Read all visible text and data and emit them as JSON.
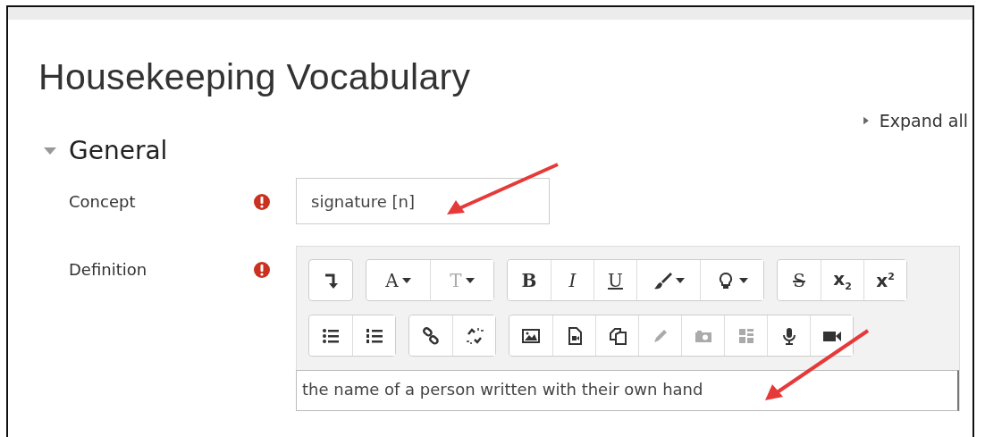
{
  "page": {
    "title": "Housekeeping Vocabulary",
    "expand_all": "Expand all"
  },
  "section": {
    "title": "General",
    "expanded": true
  },
  "fields": [
    {
      "label": "Concept",
      "required": true,
      "kind": "input",
      "value": "signature [n]"
    },
    {
      "label": "Definition",
      "required": true,
      "kind": "editor",
      "value": "the name of a person written with their own hand"
    }
  ],
  "toolbar": [
    [
      [
        {
          "kind": "arrow-down",
          "disabled": false,
          "dropdown": false
        }
      ],
      [
        {
          "kind": "font",
          "label": "A",
          "disabled": false,
          "dropdown": true
        },
        {
          "kind": "font-size",
          "label": "T",
          "disabled": true,
          "dropdown": true
        }
      ],
      [
        {
          "kind": "bold",
          "label": "B",
          "disabled": false,
          "dropdown": false
        },
        {
          "kind": "italic",
          "label": "I",
          "disabled": false,
          "dropdown": false
        },
        {
          "kind": "underline",
          "label": "U",
          "disabled": false,
          "dropdown": false
        },
        {
          "kind": "brush",
          "disabled": false,
          "dropdown": true
        },
        {
          "kind": "bulb",
          "disabled": false,
          "dropdown": true
        }
      ],
      [
        {
          "kind": "strike",
          "label": "S",
          "disabled": false,
          "dropdown": false
        },
        {
          "kind": "subscript",
          "label": "x$_{2}$",
          "disabled": false,
          "dropdown": false
        },
        {
          "kind": "superscript",
          "label": "x$^{2}$",
          "disabled": false,
          "dropdown": false
        }
      ]
    ],
    [
      [
        {
          "kind": "list",
          "disabled": false,
          "dropdown": false
        },
        {
          "kind": "numbered-list",
          "disabled": false,
          "dropdown": false
        }
      ],
      [
        {
          "kind": "link",
          "disabled": false,
          "dropdown": false
        },
        {
          "kind": "unlink",
          "disabled": false,
          "dropdown": false
        }
      ],
      [
        {
          "kind": "image",
          "disabled": false,
          "dropdown": false
        },
        {
          "kind": "media-file",
          "disabled": false,
          "dropdown": false
        },
        {
          "kind": "copy",
          "disabled": false,
          "dropdown": false
        },
        {
          "kind": "pencil",
          "disabled": true,
          "dropdown": false
        },
        {
          "kind": "camera",
          "disabled": true,
          "dropdown": false
        },
        {
          "kind": "table",
          "disabled": true,
          "dropdown": false
        },
        {
          "kind": "mic",
          "disabled": false,
          "dropdown": false
        },
        {
          "kind": "video",
          "disabled": false,
          "dropdown": false
        }
      ]
    ]
  ]
}
